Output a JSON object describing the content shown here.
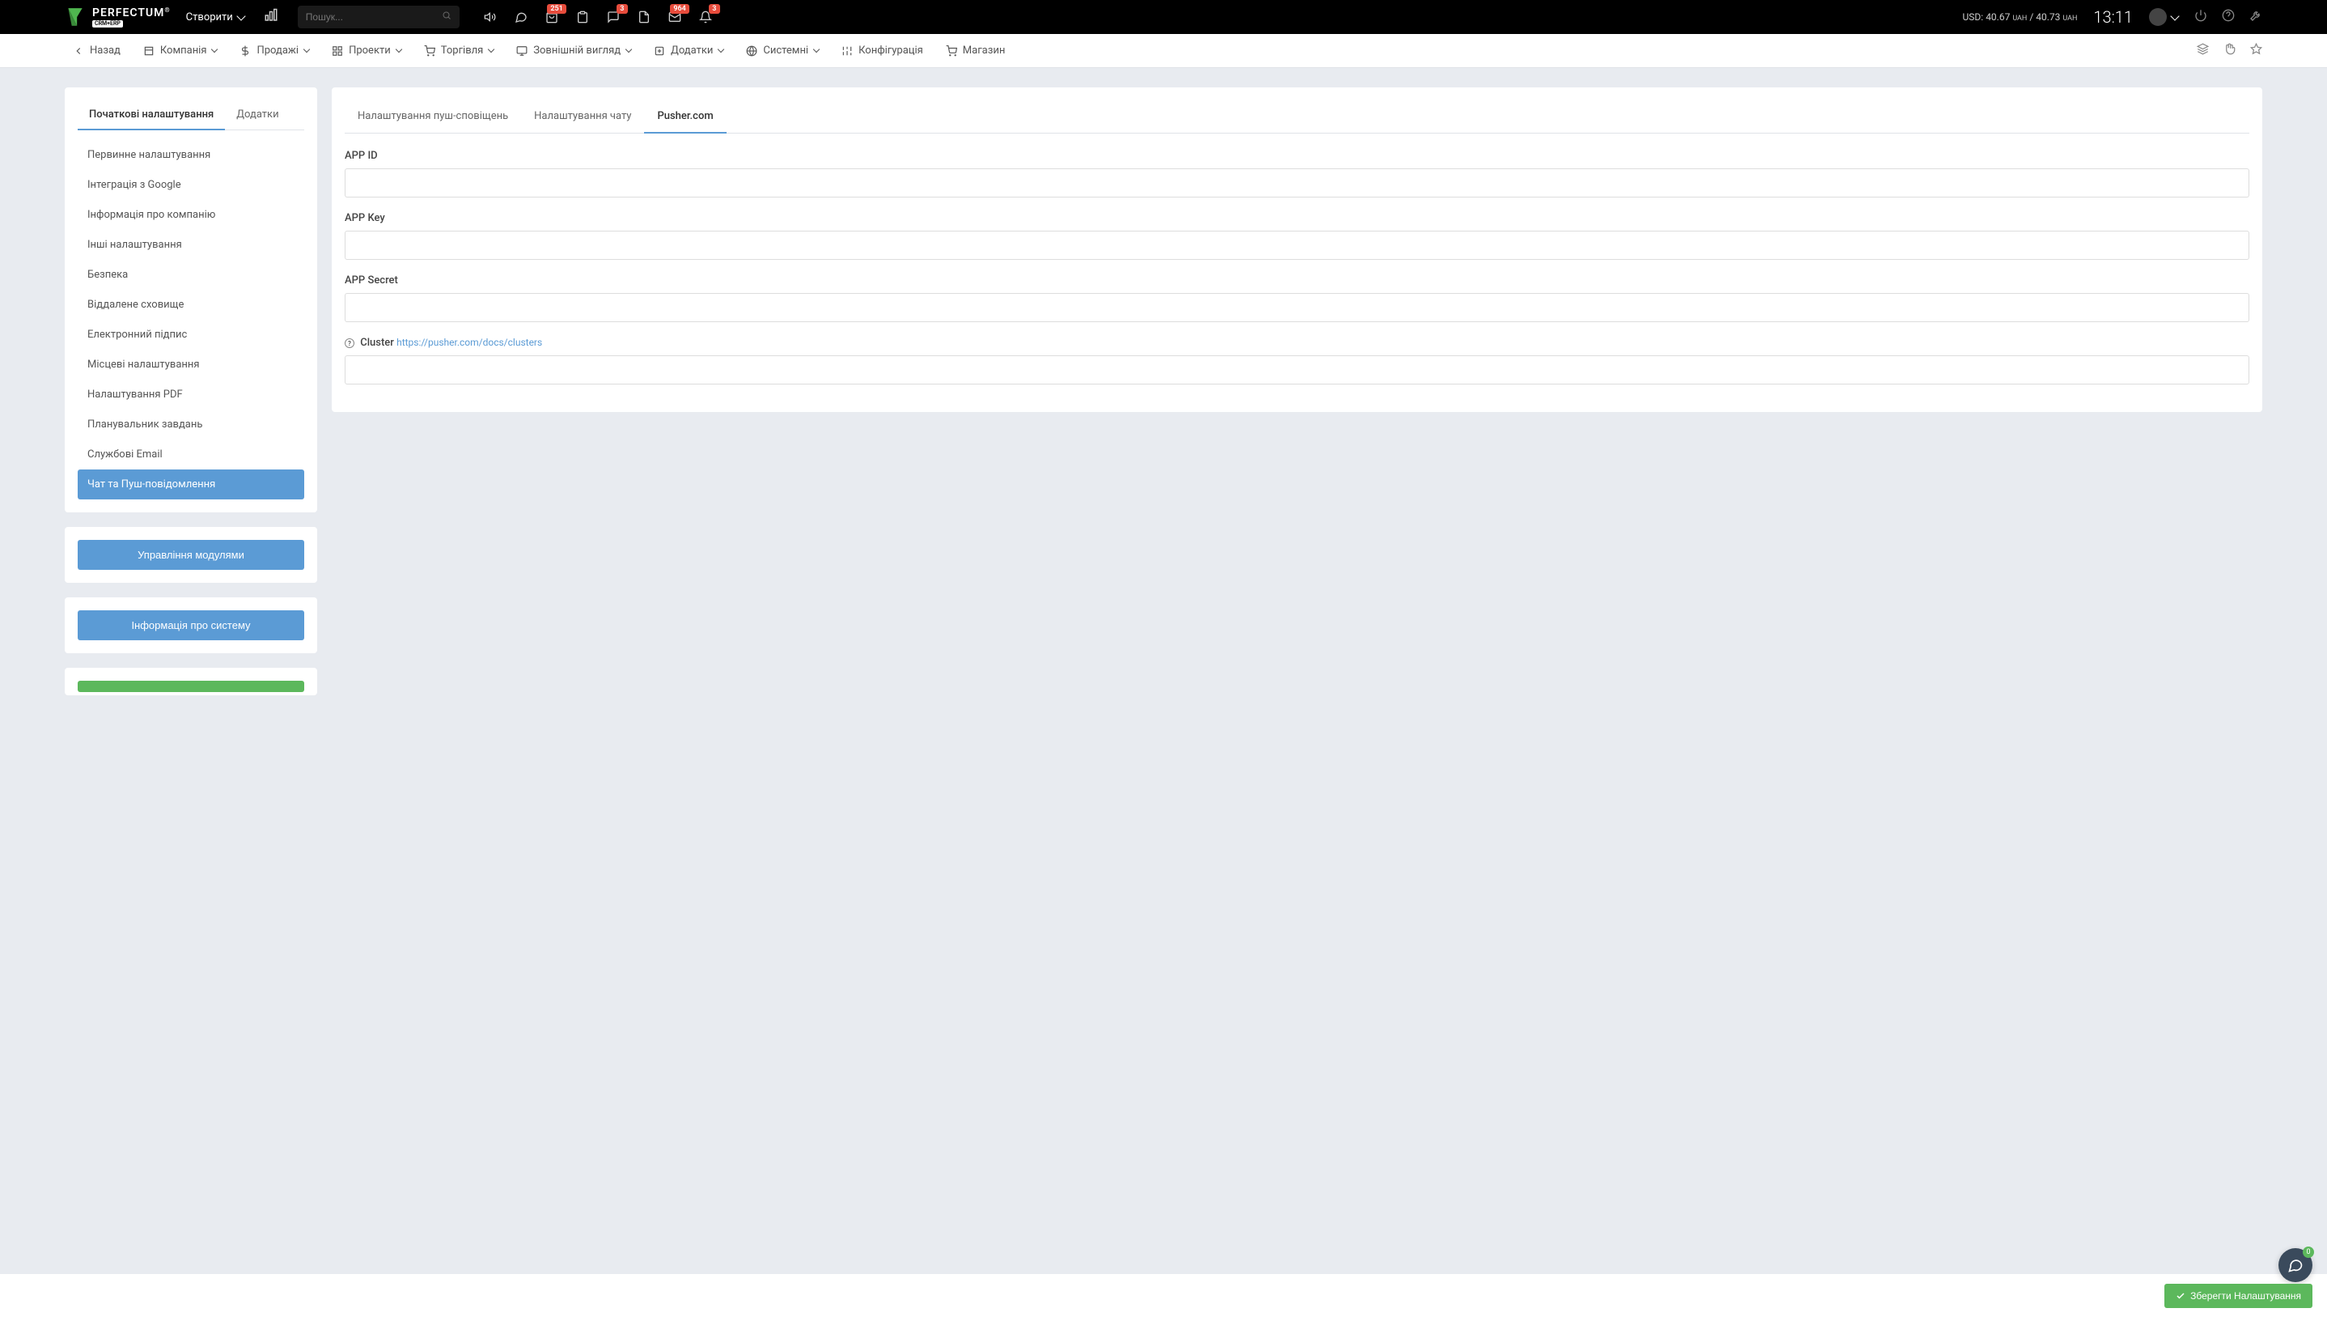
{
  "header": {
    "logo_text": "PERFECTUM",
    "logo_sub": "CRM+ERP",
    "logo_r": "®",
    "create": "Створити",
    "search_placeholder": "Пошук...",
    "badges": {
      "bag": "251",
      "chat": "3",
      "mail": "964",
      "bell": "3"
    },
    "currency_label": "USD:",
    "currency_val1": "40.67",
    "currency_unit": "UAH",
    "currency_sep": "/",
    "currency_val2": "40.73",
    "clock": "13:11"
  },
  "nav": {
    "back": "Назад",
    "items": [
      "Компанія",
      "Продажі",
      "Проекти",
      "Торгівля",
      "Зовнішній вигляд",
      "Додатки",
      "Системні",
      "Конфігурація",
      "Магазин"
    ]
  },
  "sidebar": {
    "tabs": [
      "Початкові налаштування",
      "Додатки"
    ],
    "items": [
      "Первинне налаштування",
      "Інтеграція з Google",
      "Інформація про компанію",
      "Інші налаштування",
      "Безпека",
      "Віддалене сховище",
      "Електронний підпис",
      "Місцеві налаштування",
      "Налаштування PDF",
      "Планувальник завдань",
      "Службові Email",
      "Чат та Пуш-повідомлення"
    ],
    "active_index": 11,
    "modules_btn": "Управління модулями",
    "sysinfo_btn": "Інформація про систему"
  },
  "content": {
    "tabs": [
      "Налаштування пуш-сповіщень",
      "Налаштування чату",
      "Pusher.com"
    ],
    "active_tab": 2,
    "fields": {
      "app_id": {
        "label": "APP ID",
        "value": ""
      },
      "app_key": {
        "label": "APP Key",
        "value": ""
      },
      "app_secret": {
        "label": "APP Secret",
        "value": ""
      },
      "cluster": {
        "label": "Cluster",
        "link": "https://pusher.com/docs/clusters",
        "value": ""
      }
    }
  },
  "fab_badge": "0",
  "save_btn": "Зберегти Налаштування"
}
